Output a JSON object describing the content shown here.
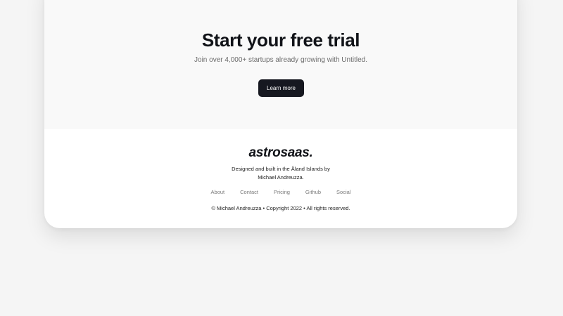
{
  "cta": {
    "title": "Start your free trial",
    "subtitle": "Join over 4,000+ startups already growing with Untitled.",
    "button_label": "Learn more"
  },
  "footer": {
    "logo": "astrosaas.",
    "tagline_line1": "Designed and built in the Åland Islands by",
    "tagline_line2": "Michael Andreuzza.",
    "nav": [
      {
        "label": "About"
      },
      {
        "label": "Contact"
      },
      {
        "label": "Pricing"
      },
      {
        "label": "Github"
      },
      {
        "label": "Social"
      }
    ],
    "copyright": "© Michael Andreuzza • Copyright 2022 • All rights reserved."
  },
  "colors": {
    "page_background": "#f5f5f5",
    "cta_background": "#f9f9f9",
    "button_background": "#161820",
    "text_primary": "#111318",
    "text_muted": "#7a7a7a"
  }
}
